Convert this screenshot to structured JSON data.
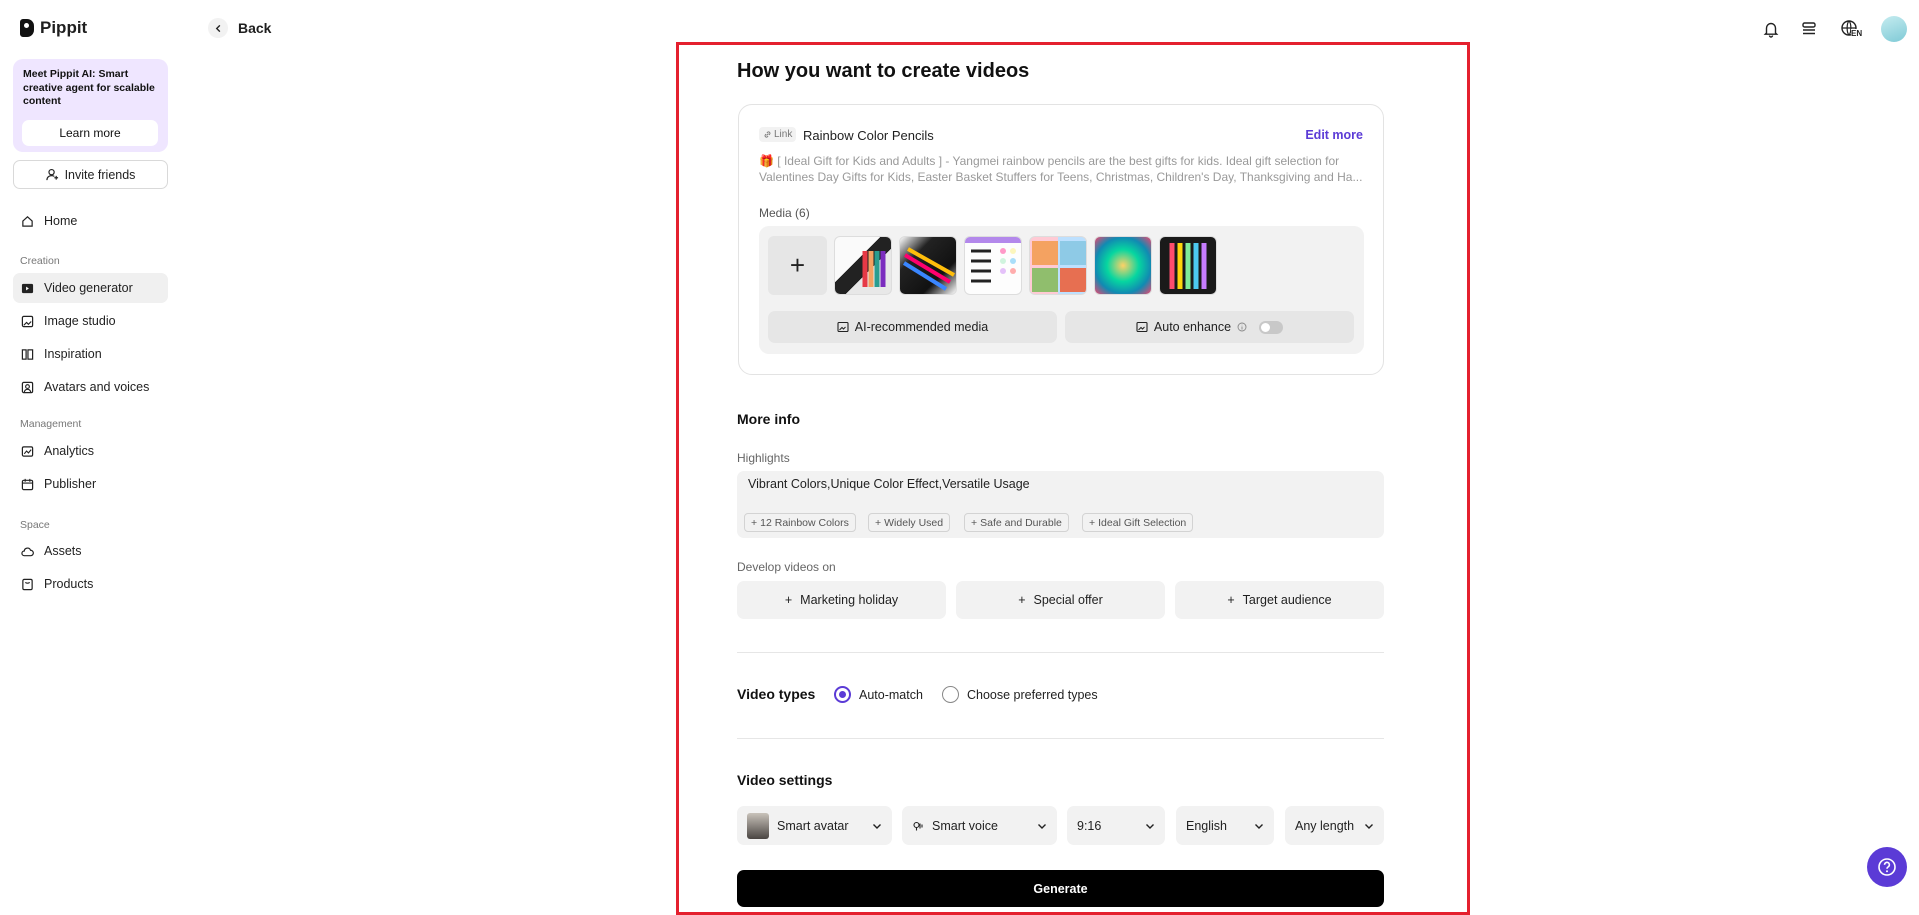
{
  "app": {
    "name": "Pippit"
  },
  "promo": {
    "text": "Meet Pippit AI: Smart creative agent for scalable content",
    "button": "Learn more"
  },
  "invite": {
    "label": "Invite friends"
  },
  "nav": {
    "home": "Home",
    "creation_section": "Creation",
    "video_generator": "Video generator",
    "image_studio": "Image studio",
    "inspiration": "Inspiration",
    "avatars_voices": "Avatars and voices",
    "management_section": "Management",
    "analytics": "Analytics",
    "publisher": "Publisher",
    "space_section": "Space",
    "assets": "Assets",
    "products": "Products"
  },
  "header": {
    "back": "Back",
    "lang": "EN"
  },
  "page": {
    "title": "How you want to create videos"
  },
  "product": {
    "link_chip": "Link",
    "title": "Rainbow Color Pencils",
    "edit_more": "Edit more",
    "desc_line1": "[ Ideal Gift for Kids and Adults ] - Yangmei rainbow pencils are the best gifts for kids. Ideal gift selection for",
    "desc_line2": "Valentines Day Gifts for Kids, Easter Basket Stuffers for Teens, Christmas, Children's Day, Thanksgiving and Ha...",
    "media_label": "Media (6)",
    "ai_media": "AI-recommended media",
    "auto_enhance": "Auto enhance"
  },
  "more_info": {
    "title": "More info",
    "highlights_label": "Highlights",
    "highlights_value": "Vibrant Colors,Unique Color Effect,Versatile Usage",
    "tags": [
      "12 Rainbow Colors",
      "Widely Used",
      "Safe and Durable",
      "Ideal Gift Selection"
    ],
    "develop_label": "Develop videos on",
    "develop_options": [
      "Marketing holiday",
      "Special offer",
      "Target audience"
    ]
  },
  "video_types": {
    "title": "Video types",
    "options": [
      "Auto-match",
      "Choose preferred types"
    ],
    "selected": "Auto-match"
  },
  "video_settings": {
    "title": "Video settings",
    "avatar": "Smart avatar",
    "voice": "Smart voice",
    "ratio": "9:16",
    "language": "English",
    "length": "Any length"
  },
  "generate": {
    "label": "Generate"
  },
  "colors": {
    "accent": "#5b3bd6",
    "highlight_frame": "#e4202e",
    "primary_button": "#000000"
  }
}
